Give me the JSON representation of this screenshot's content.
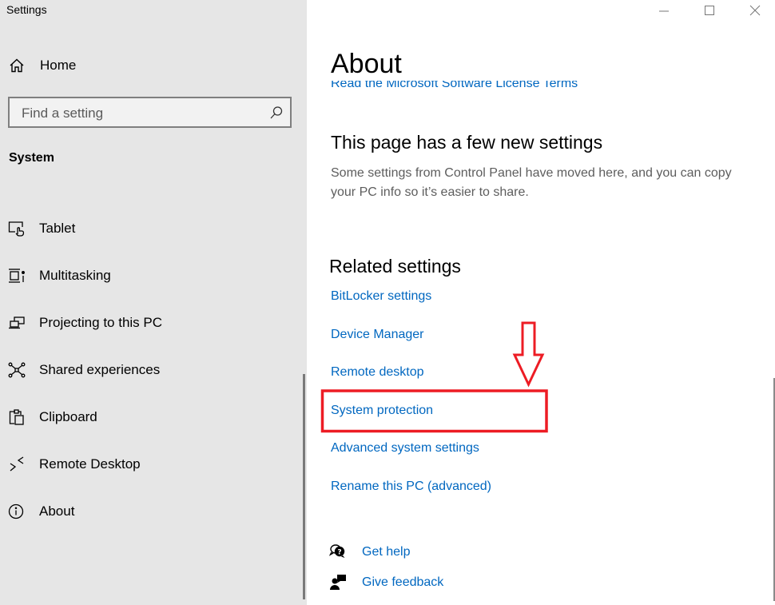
{
  "app": {
    "title": "Settings"
  },
  "window_controls": {
    "minimize": "minimize-icon",
    "maximize": "maximize-icon",
    "close": "close-icon"
  },
  "sidebar": {
    "home": {
      "label": "Home",
      "icon": "home-icon"
    },
    "search": {
      "placeholder": "Find a setting",
      "value": "",
      "icon": "search-icon"
    },
    "section": "System",
    "items": [
      {
        "label": "Tablet",
        "icon": "tablet-icon"
      },
      {
        "label": "Multitasking",
        "icon": "multitasking-icon"
      },
      {
        "label": "Projecting to this PC",
        "icon": "projecting-icon"
      },
      {
        "label": "Shared experiences",
        "icon": "shared-experiences-icon"
      },
      {
        "label": "Clipboard",
        "icon": "clipboard-icon"
      },
      {
        "label": "Remote Desktop",
        "icon": "remote-desktop-icon"
      },
      {
        "label": "About",
        "icon": "info-icon"
      }
    ]
  },
  "main": {
    "title": "About",
    "license_link": "Read the Microsoft Software License Terms",
    "new_settings": {
      "heading": "This page has a few new settings",
      "description": "Some settings from Control Panel have moved here, and you can copy your PC info so it’s easier to share."
    },
    "related": {
      "heading": "Related settings",
      "links": [
        "BitLocker settings",
        "Device Manager",
        "Remote desktop",
        "System protection",
        "Advanced system settings",
        "Rename this PC (advanced)"
      ],
      "highlighted_index": 3
    },
    "help": [
      {
        "label": "Get help",
        "icon": "get-help-icon"
      },
      {
        "label": "Give feedback",
        "icon": "give-feedback-icon"
      }
    ]
  },
  "annotation": {
    "color": "#ed1c24",
    "target": "System protection"
  }
}
